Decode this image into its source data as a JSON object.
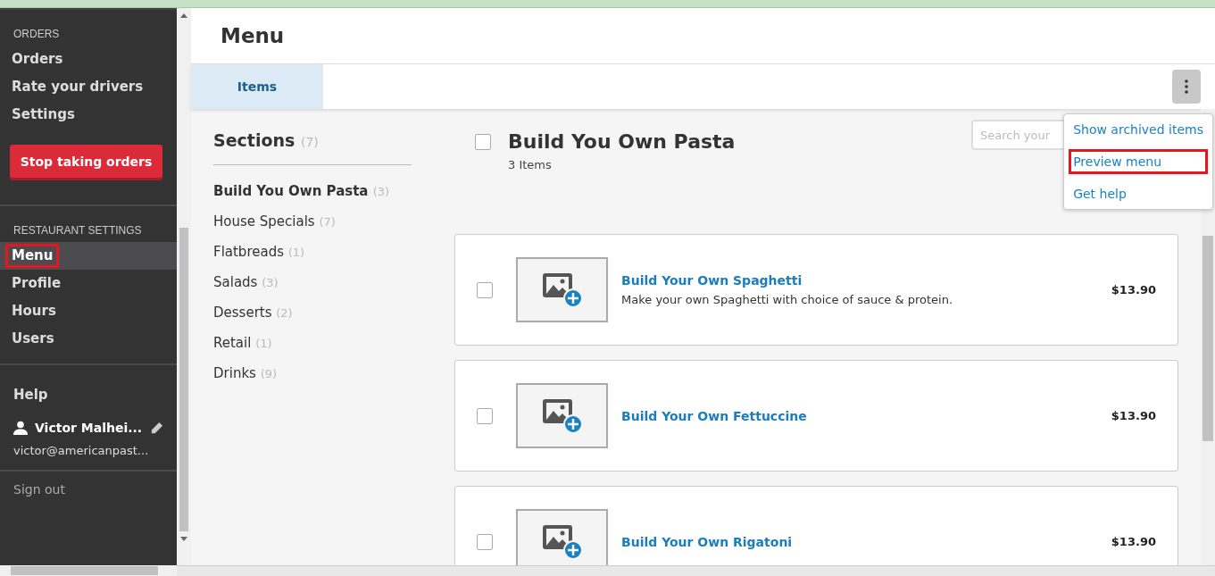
{
  "sidebar": {
    "groups": [
      {
        "heading": "ORDERS",
        "items": [
          {
            "label": "Orders",
            "selected": false,
            "highlighted": false
          },
          {
            "label": "Rate your drivers",
            "selected": false,
            "highlighted": false
          },
          {
            "label": "Settings",
            "selected": false,
            "highlighted": false
          }
        ],
        "button": "Stop taking orders"
      },
      {
        "heading": "RESTAURANT SETTINGS",
        "items": [
          {
            "label": "Menu",
            "selected": true,
            "highlighted": true
          },
          {
            "label": "Profile",
            "selected": false,
            "highlighted": false
          },
          {
            "label": "Hours",
            "selected": false,
            "highlighted": false
          },
          {
            "label": "Users",
            "selected": false,
            "highlighted": false
          }
        ]
      }
    ],
    "help": "Help",
    "user": {
      "name": "Victor Malhei...",
      "email": "victor@americanpast..."
    },
    "sign_out": "Sign out"
  },
  "page": {
    "title": "Menu",
    "tabs": [
      {
        "label": "Items",
        "selected": true
      }
    ]
  },
  "menu_popup": {
    "items": [
      {
        "label": "Show archived items",
        "highlighted": false
      },
      {
        "label": "Preview menu",
        "highlighted": true
      },
      {
        "label": "Get help",
        "highlighted": false
      }
    ]
  },
  "sections": {
    "title": "Sections",
    "count": "(7)",
    "items": [
      {
        "name": "Build You Own Pasta",
        "count": "(3)",
        "selected": true
      },
      {
        "name": "House Specials",
        "count": "(7)",
        "selected": false
      },
      {
        "name": "Flatbreads",
        "count": "(1)",
        "selected": false
      },
      {
        "name": "Salads",
        "count": "(3)",
        "selected": false
      },
      {
        "name": "Desserts",
        "count": "(2)",
        "selected": false
      },
      {
        "name": "Retail",
        "count": "(1)",
        "selected": false
      },
      {
        "name": "Drinks",
        "count": "(9)",
        "selected": false
      }
    ]
  },
  "section_detail": {
    "title": "Build You Own Pasta",
    "subtitle": "3 Items",
    "checked": false,
    "search": {
      "placeholder": "Search your"
    },
    "items": [
      {
        "name": "Build Your Own Spaghetti",
        "description": "Make your own Spaghetti with choice of sauce & protein.",
        "price": "$13.90",
        "checked": false
      },
      {
        "name": "Build Your Own Fettuccine",
        "price": "$13.90",
        "checked": false
      },
      {
        "name": "Build Your Own Rigatoni",
        "price": "$13.90",
        "checked": false
      }
    ]
  }
}
